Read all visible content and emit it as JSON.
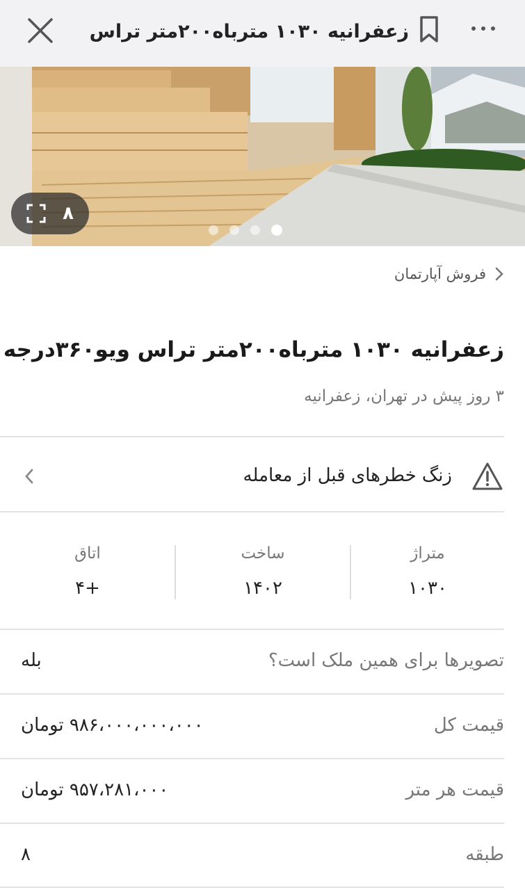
{
  "header": {
    "title": "زعفرانیه ۱۰۳۰ متر‌باه۲۰۰متر تراس وی...",
    "close_icon": "close-icon",
    "bookmark_icon": "bookmark-icon",
    "more_icon": "more-horizontal-icon"
  },
  "gallery": {
    "image_count": "۸",
    "fullscreen_icon": "fullscreen-icon",
    "dots_total": 4,
    "active_dot": 4
  },
  "breadcrumb": {
    "label": "فروش آپارتمان",
    "icon": "chevron-left-icon"
  },
  "listing": {
    "title": "زعفرانیه ۱۰۳۰ متر‌باه۲۰۰متر تراس ویو۳۶۰درجه",
    "subtitle": "۳ روز پیش در تهران، زعفرانیه"
  },
  "alert": {
    "label": "زنگ خطرهای قبل از معامله",
    "icon": "warning-triangle-icon",
    "chevron_icon": "chevron-left-icon"
  },
  "stats": [
    {
      "label": "متراژ",
      "value": "۱۰۳۰"
    },
    {
      "label": "ساخت",
      "value": "۱۴۰۲"
    },
    {
      "label": "اتاق",
      "value": "+۴"
    }
  ],
  "details": [
    {
      "label": "تصویرها برای همین ملک است؟",
      "value": "بله"
    },
    {
      "label": "قیمت کل",
      "value": "۹۸۶،۰۰۰،۰۰۰،۰۰۰ تومان"
    },
    {
      "label": "قیمت هر متر",
      "value": "۹۵۷،۲۸۱،۰۰۰ تومان"
    },
    {
      "label": "طبقه",
      "value": "۸"
    }
  ]
}
